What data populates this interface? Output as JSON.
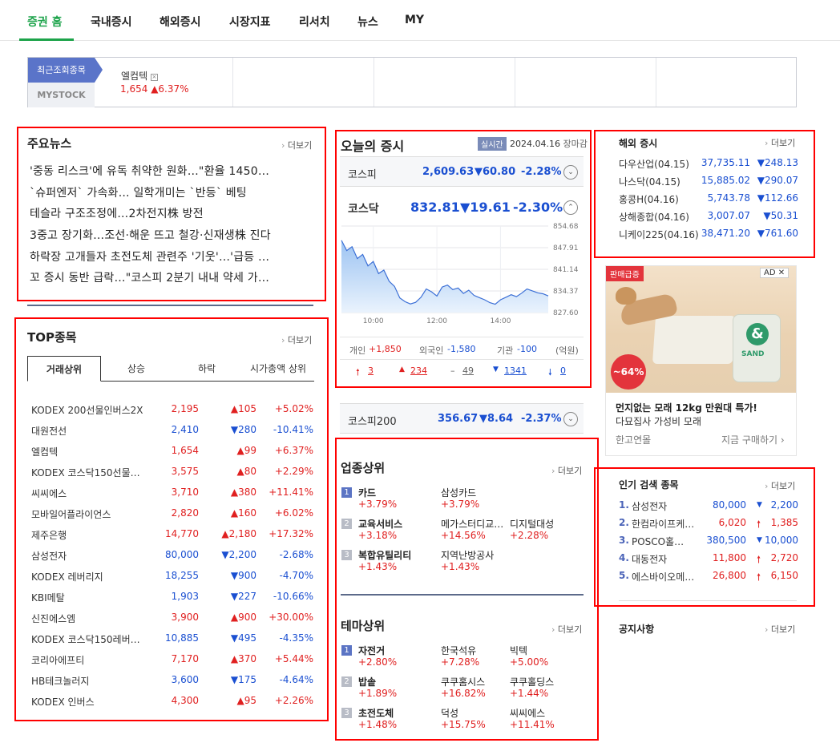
{
  "nav": {
    "items": [
      "증권 홈",
      "국내증시",
      "해외증시",
      "시장지표",
      "리서치",
      "뉴스",
      "MY"
    ]
  },
  "recent": {
    "tab_label": "최근조회종목",
    "mystock_label": "MYSTOCK",
    "item": {
      "name": "엘컴텍",
      "price": "1,654",
      "change": "▲6.37%"
    }
  },
  "news": {
    "title": "주요뉴스",
    "more": "더보기",
    "items": [
      "'중동 리스크'에 유독 취약한 원화…\"환율 1450…",
      "`슈퍼엔저` 가속화… 일학개미는 `반등` 베팅",
      "테슬라 구조조정에…2차전지株 방전",
      "3중고 장기화…조선·해운 뜨고 철강·신재생株 진다",
      "하락장 고개들자 초전도체 관련주 '기웃'…'급등 …",
      "꼬 증시 동반 급락…\"코스피 2분기 내내 약세 가…"
    ]
  },
  "top": {
    "title": "TOP종목",
    "more": "더보기",
    "tabs": [
      "거래상위",
      "상승",
      "하락",
      "시가총액 상위"
    ],
    "rows": [
      {
        "name": "KODEX 200선물인버스2X",
        "price": "2,195",
        "chg": "▲105",
        "pct": "+5.02%",
        "dir": "up"
      },
      {
        "name": "대원전선",
        "price": "2,410",
        "chg": "▼280",
        "pct": "-10.41%",
        "dir": "down"
      },
      {
        "name": "엘컴텍",
        "price": "1,654",
        "chg": "▲99",
        "pct": "+6.37%",
        "dir": "up"
      },
      {
        "name": "KODEX 코스닥150선물…",
        "price": "3,575",
        "chg": "▲80",
        "pct": "+2.29%",
        "dir": "up"
      },
      {
        "name": "씨씨에스",
        "price": "3,710",
        "chg": "▲380",
        "pct": "+11.41%",
        "dir": "up"
      },
      {
        "name": "모바일어플라이언스",
        "price": "2,820",
        "chg": "▲160",
        "pct": "+6.02%",
        "dir": "up"
      },
      {
        "name": "제주은행",
        "price": "14,770",
        "chg": "▲2,180",
        "pct": "+17.32%",
        "dir": "up"
      },
      {
        "name": "삼성전자",
        "price": "80,000",
        "chg": "▼2,200",
        "pct": "-2.68%",
        "dir": "down"
      },
      {
        "name": "KODEX 레버리지",
        "price": "18,255",
        "chg": "▼900",
        "pct": "-4.70%",
        "dir": "down"
      },
      {
        "name": "KBI메탈",
        "price": "1,903",
        "chg": "▼227",
        "pct": "-10.66%",
        "dir": "down"
      },
      {
        "name": "신진에스엠",
        "price": "3,900",
        "chg": "▲900",
        "pct": "+30.00%",
        "dir": "up"
      },
      {
        "name": "KODEX 코스닥150레버…",
        "price": "10,885",
        "chg": "▼495",
        "pct": "-4.35%",
        "dir": "down"
      },
      {
        "name": "코리아에프티",
        "price": "7,170",
        "chg": "▲370",
        "pct": "+5.44%",
        "dir": "up"
      },
      {
        "name": "HB테크놀러지",
        "price": "3,600",
        "chg": "▼175",
        "pct": "-4.64%",
        "dir": "down"
      },
      {
        "name": "KODEX 인버스",
        "price": "4,300",
        "chg": "▲95",
        "pct": "+2.26%",
        "dir": "up"
      }
    ]
  },
  "market": {
    "title": "오늘의 증시",
    "badge": "실시간",
    "date": "2024.04.16",
    "status": "장마감",
    "kospi": {
      "name": "코스피",
      "value": "2,609.63",
      "chg": "▼60.80",
      "pct": "-2.28%"
    },
    "kosdaq": {
      "name": "코스닥",
      "value": "832.81",
      "chg": "▼19.61",
      "pct": "-2.30%"
    },
    "kospi200": {
      "name": "코스피200",
      "value": "356.67",
      "chg": "▼8.64",
      "pct": "-2.37%"
    },
    "investors": {
      "individual_label": "개인",
      "individual": "+1,850",
      "foreign_label": "외국인",
      "foreign": "-1,580",
      "inst_label": "기관",
      "inst": "-100",
      "unit": "(억원)"
    },
    "breadth": {
      "upper": "3",
      "up": "234",
      "flat": "49",
      "down": "1341",
      "lower": "0"
    }
  },
  "chart_data": {
    "type": "area",
    "x": [
      "09:00",
      "09:10",
      "09:20",
      "09:30",
      "09:40",
      "09:50",
      "10:00",
      "10:10",
      "10:20",
      "10:30",
      "10:40",
      "10:50",
      "11:00",
      "11:10",
      "11:20",
      "11:30",
      "11:40",
      "11:50",
      "12:00",
      "12:10",
      "12:20",
      "12:30",
      "12:40",
      "12:50",
      "13:00",
      "13:10",
      "13:20",
      "13:30",
      "13:40",
      "13:50",
      "14:00",
      "14:10",
      "14:20",
      "14:30",
      "14:40",
      "14:50",
      "15:00",
      "15:10",
      "15:20",
      "15:30"
    ],
    "values": [
      850.2,
      847.0,
      848.2,
      844.5,
      845.8,
      842.2,
      843.6,
      839.8,
      840.9,
      837.4,
      835.8,
      832.2,
      831.0,
      830.3,
      830.8,
      832.4,
      835.0,
      834.1,
      832.8,
      835.6,
      836.2,
      834.8,
      835.3,
      833.6,
      834.6,
      833.0,
      832.3,
      831.6,
      830.7,
      830.2,
      831.6,
      832.4,
      833.2,
      832.6,
      833.7,
      835.0,
      834.4,
      833.8,
      833.5,
      832.81
    ],
    "ylim": [
      827.6,
      854.68
    ],
    "ytick_labels": [
      "854.68",
      "847.91",
      "841.14",
      "834.37",
      "827.60"
    ],
    "xtick_labels": [
      "10:00",
      "12:00",
      "14:00"
    ]
  },
  "sector": {
    "title": "업종상위",
    "more": "더보기",
    "rows": [
      [
        {
          "name": "카드",
          "pct": "+3.79%"
        },
        {
          "name": "삼성카드",
          "pct": "+3.79%"
        }
      ],
      [
        {
          "name": "교육서비스",
          "pct": "+3.18%"
        },
        {
          "name": "메가스터디교…",
          "pct": "+14.56%"
        },
        {
          "name": "디지털대성",
          "pct": "+2.28%"
        }
      ],
      [
        {
          "name": "복합유틸리티",
          "pct": "+1.43%"
        },
        {
          "name": "지역난방공사",
          "pct": "+1.43%"
        }
      ]
    ]
  },
  "theme": {
    "title": "테마상위",
    "more": "더보기",
    "rows": [
      [
        {
          "name": "자전거",
          "pct": "+2.80%"
        },
        {
          "name": "한국석유",
          "pct": "+7.28%"
        },
        {
          "name": "빅텍",
          "pct": "+5.00%"
        }
      ],
      [
        {
          "name": "밥솥",
          "pct": "+1.89%"
        },
        {
          "name": "쿠쿠홈시스",
          "pct": "+16.82%"
        },
        {
          "name": "쿠쿠홀딩스",
          "pct": "+1.44%"
        }
      ],
      [
        {
          "name": "초전도체",
          "pct": "+1.48%"
        },
        {
          "name": "덕성",
          "pct": "+15.75%"
        },
        {
          "name": "씨씨에스",
          "pct": "+11.41%"
        }
      ]
    ]
  },
  "overseas": {
    "title": "해외 증시",
    "more": "더보기",
    "rows": [
      {
        "name": "다우산업(04.15)",
        "value": "37,735.11",
        "chg": "▼248.13"
      },
      {
        "name": "나스닥(04.15)",
        "value": "15,885.02",
        "chg": "▼290.07"
      },
      {
        "name": "홍콩H(04.16)",
        "value": "5,743.78",
        "chg": "▼112.66"
      },
      {
        "name": "상해종합(04.16)",
        "value": "3,007.07",
        "chg": "▼50.31"
      },
      {
        "name": "니케이225(04.16)",
        "value": "38,471.20",
        "chg": "▼761.60"
      }
    ]
  },
  "ad": {
    "tag": "판매급증",
    "ad_label": "AD",
    "discount": "~64%",
    "title": "먼지없는 모래 12kg 만원대 특가!",
    "subtitle": "다묘집사 가성비 모래",
    "brand": "한고연몰",
    "cta": "지금 구매하기 ›",
    "bag_text": "SAND"
  },
  "popular": {
    "title": "인기 검색 종목",
    "more": "더보기",
    "rows": [
      {
        "rank": "1.",
        "name": "삼성전자",
        "price": "80,000",
        "chg": "2,200",
        "dir": "down"
      },
      {
        "rank": "2.",
        "name": "한컴라이프케…",
        "price": "6,020",
        "chg": "1,385",
        "dir": "upper"
      },
      {
        "rank": "3.",
        "name": "POSCO홀…",
        "price": "380,500",
        "chg": "10,000",
        "dir": "down"
      },
      {
        "rank": "4.",
        "name": "대동전자",
        "price": "11,800",
        "chg": "2,720",
        "dir": "upper"
      },
      {
        "rank": "5.",
        "name": "에스바이오메…",
        "price": "26,800",
        "chg": "6,150",
        "dir": "upper"
      }
    ]
  },
  "notice": {
    "title": "공지사항",
    "more": "더보기"
  }
}
